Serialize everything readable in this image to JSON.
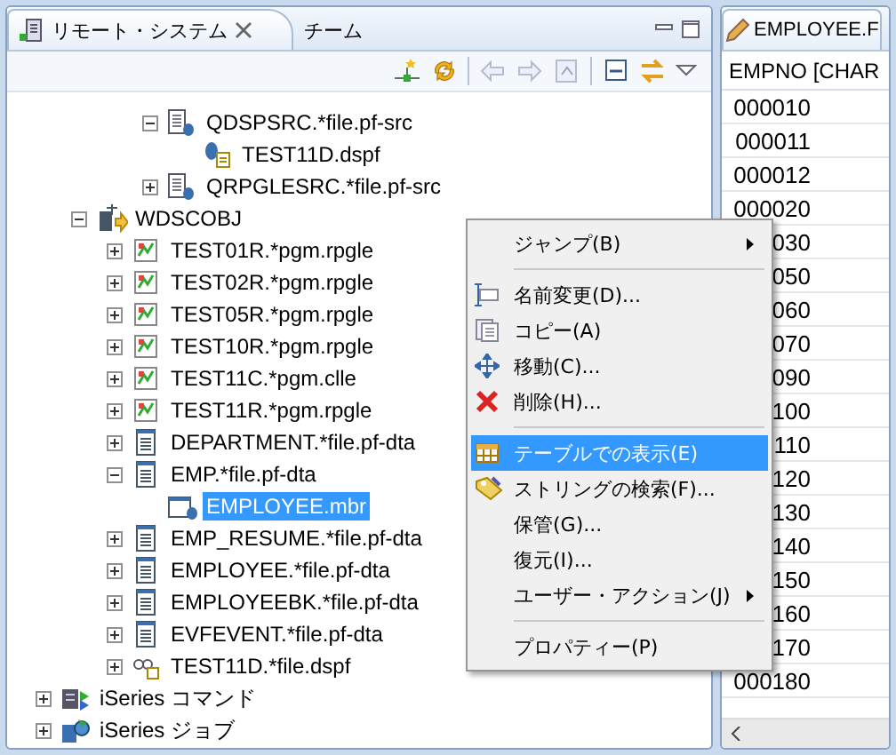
{
  "left_panel": {
    "tabs": [
      {
        "label": "リモート・システム",
        "selected": true
      },
      {
        "label": "チーム",
        "selected": false
      }
    ],
    "tree": [
      {
        "children": [
          {
            "children": [
              {
                "children": [
                  {
                    "children": [
                      {
                        "label": "QDSPSRC.*file.pf-src",
                        "kind": "source-file",
                        "expanded": true,
                        "selected": false,
                        "children": [
                          {
                            "label": "TEST11D.dspf",
                            "kind": "member",
                            "selected": false
                          }
                        ]
                      },
                      {
                        "label": "QRPGLESRC.*file.pf-src",
                        "kind": "source-file",
                        "expanded": false,
                        "selected": false
                      }
                    ]
                  }
                ]
              },
              {
                "label": "WDSCOBJ",
                "kind": "library",
                "expanded": true,
                "selected": false,
                "children": [
                  {
                    "label": "TEST01R.*pgm.rpgle",
                    "kind": "program",
                    "expanded": false,
                    "selected": false
                  },
                  {
                    "label": "TEST02R.*pgm.rpgle",
                    "kind": "program",
                    "expanded": false,
                    "selected": false
                  },
                  {
                    "label": "TEST05R.*pgm.rpgle",
                    "kind": "program",
                    "expanded": false,
                    "selected": false
                  },
                  {
                    "label": "TEST10R.*pgm.rpgle",
                    "kind": "program",
                    "expanded": false,
                    "selected": false
                  },
                  {
                    "label": "TEST11C.*pgm.clle",
                    "kind": "program",
                    "expanded": false,
                    "selected": false
                  },
                  {
                    "label": "TEST11R.*pgm.rpgle",
                    "kind": "program",
                    "expanded": false,
                    "selected": false
                  },
                  {
                    "label": "DEPARTMENT.*file.pf-dta",
                    "kind": "data-file",
                    "expanded": false,
                    "selected": false
                  },
                  {
                    "label": "EMP.*file.pf-dta",
                    "kind": "data-file",
                    "expanded": true,
                    "selected": false,
                    "children": [
                      {
                        "label": "EMPLOYEE.mbr",
                        "kind": "data-member",
                        "selected": true
                      }
                    ]
                  },
                  {
                    "label": "EMP_RESUME.*file.pf-dta",
                    "kind": "data-file",
                    "expanded": false,
                    "selected": false
                  },
                  {
                    "label": "EMPLOYEE.*file.pf-dta",
                    "kind": "data-file",
                    "expanded": false,
                    "selected": false
                  },
                  {
                    "label": "EMPLOYEEBK.*file.pf-dta",
                    "kind": "data-file",
                    "expanded": false,
                    "selected": false
                  },
                  {
                    "label": "EVFEVENT.*file.pf-dta",
                    "kind": "data-file",
                    "expanded": false,
                    "selected": false
                  },
                  {
                    "label": "TEST11D.*file.dspf",
                    "kind": "display-file",
                    "expanded": false,
                    "selected": false
                  }
                ]
              }
            ]
          },
          {
            "label": "iSeries コマンド",
            "kind": "commands",
            "expanded": false,
            "selected": false
          },
          {
            "label": "iSeries ジョブ",
            "kind": "jobs",
            "expanded": false,
            "selected": false
          }
        ]
      }
    ]
  },
  "context_menu": {
    "items": [
      {
        "kind": "item",
        "label": "ジャンプ(B)",
        "submenu": true,
        "selected": false
      },
      {
        "kind": "separator"
      },
      {
        "kind": "item",
        "label": "名前変更(D)...",
        "submenu": false,
        "selected": false
      },
      {
        "kind": "item",
        "label": "コピー(A)",
        "submenu": false,
        "selected": false
      },
      {
        "kind": "item",
        "label": "移動(C)...",
        "submenu": false,
        "selected": false
      },
      {
        "kind": "item",
        "label": "削除(H)...",
        "submenu": false,
        "selected": false
      },
      {
        "kind": "separator"
      },
      {
        "kind": "item",
        "label": "テーブルでの表示(E)",
        "submenu": false,
        "selected": true
      },
      {
        "kind": "item",
        "label": "ストリングの検索(F)...",
        "submenu": false,
        "selected": false
      },
      {
        "kind": "item",
        "label": "保管(G)...",
        "submenu": false,
        "selected": false
      },
      {
        "kind": "item",
        "label": "復元(I)...",
        "submenu": false,
        "selected": false
      },
      {
        "kind": "item",
        "label": "ユーザー・アクション(J)",
        "submenu": true,
        "selected": false
      },
      {
        "kind": "separator"
      },
      {
        "kind": "item",
        "label": "プロパティー(P)",
        "submenu": false,
        "selected": false
      }
    ]
  },
  "editor": {
    "tab": {
      "label": "EMPLOYEE.F"
    },
    "column_header": "EMPNO [CHAR",
    "rows": [
      "000010",
      "000011",
      "000012",
      "000020",
      "030",
      "050",
      "060",
      "070",
      "090",
      "100",
      "110",
      "120",
      "130",
      "140",
      "150",
      "160",
      "170",
      "000180"
    ]
  }
}
